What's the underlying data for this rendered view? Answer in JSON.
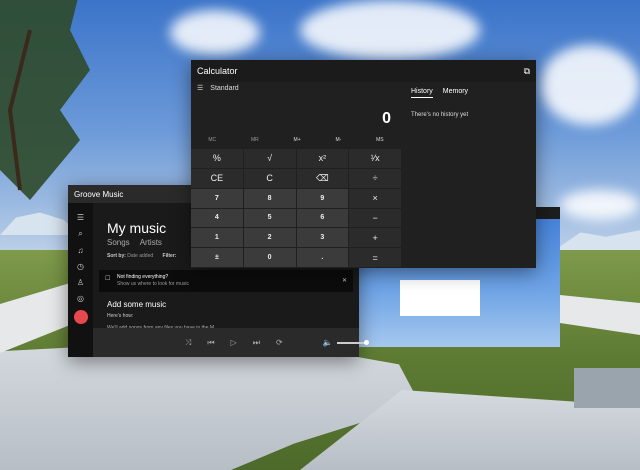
{
  "calculator": {
    "title": "Calculator",
    "mode": "Standard",
    "display": "0",
    "memory_buttons": [
      "MC",
      "MR",
      "M+",
      "M-",
      "MS"
    ],
    "keys": [
      "%",
      "√",
      "x²",
      "¹⁄x",
      "CE",
      "C",
      "⌫",
      "÷",
      "7",
      "8",
      "9",
      "×",
      "4",
      "5",
      "6",
      "−",
      "1",
      "2",
      "3",
      "+",
      "±",
      "0",
      ".",
      "="
    ],
    "tabs": [
      "History",
      "Memory"
    ],
    "history_empty": "There's no history yet"
  },
  "groove": {
    "title": "Groove Music",
    "heading": "My music",
    "subtabs": [
      "Songs",
      "Artists"
    ],
    "sort_label": "Sort by:",
    "sort_value": "Date added",
    "filter_label": "Filter:",
    "info_title": "Not finding everything?",
    "info_sub": "Show us where to look for music",
    "add_heading": "Add some music",
    "how": "Here's how:",
    "cut_text": "We'll add songs from any files you have in the M"
  },
  "accent_colors": {
    "groove": "#e5484d",
    "calc_bg": "#202020"
  }
}
